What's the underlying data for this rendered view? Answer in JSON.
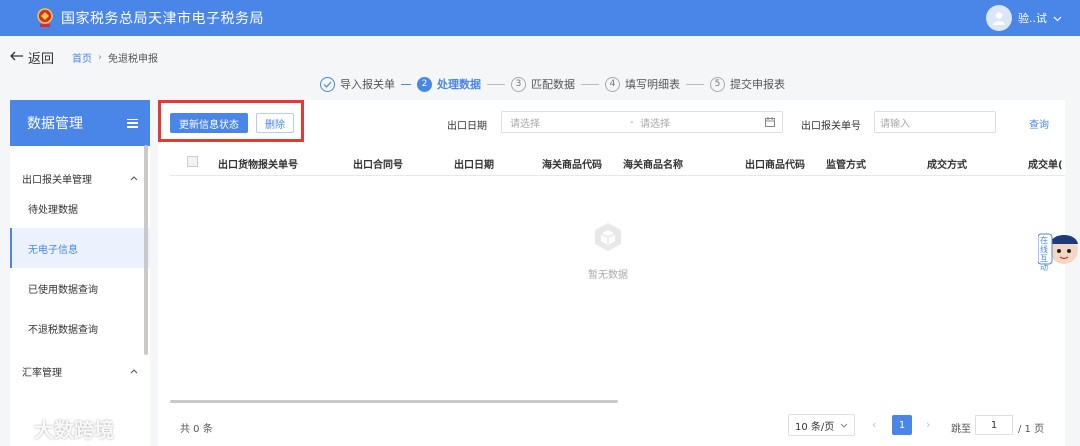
{
  "header": {
    "title": "国家税务总局天津市电子税务局",
    "user_name": "验..试"
  },
  "breadcrumb": {
    "back": "返回",
    "home": "首页",
    "sep": "›",
    "current": "免退税申报"
  },
  "steps": [
    {
      "num": "1",
      "label": "导入报关单",
      "state": "done"
    },
    {
      "num": "2",
      "label": "处理数据",
      "state": "active"
    },
    {
      "num": "3",
      "label": "匹配数据",
      "state": "todo"
    },
    {
      "num": "4",
      "label": "填写明细表",
      "state": "todo"
    },
    {
      "num": "5",
      "label": "提交申报表",
      "state": "todo"
    }
  ],
  "sidebar": {
    "title": "数据管理",
    "group1": "出口报关单管理",
    "items": [
      "待处理数据",
      "无电子信息",
      "已使用数据查询",
      "不退税数据查询"
    ],
    "group2": "汇率管理"
  },
  "toolbar": {
    "update_status": "更新信息状态",
    "delete": "删除",
    "date_label": "出口日期",
    "date_start_placeholder": "请选择",
    "date_sep": "-",
    "date_end_placeholder": "请选择",
    "declaration_label": "出口报关单号",
    "declaration_placeholder": "请输入",
    "query": "查询"
  },
  "table": {
    "columns": [
      "出口货物报关单号",
      "出口合同号",
      "出口日期",
      "海关商品代码",
      "海关商品名称",
      "出口商品代码",
      "监管方式",
      "成交方式",
      "成交单("
    ],
    "empty_text": "暂无数据"
  },
  "pagination": {
    "total": "共 0 条",
    "page_size": "10 条/页",
    "current_page": "1",
    "goto_label": "跳至",
    "goto_value": "1",
    "total_pages": "/ 1 页"
  },
  "mascot_text": "在线互动",
  "watermark": "大数跨境",
  "colors": {
    "primary": "#4a86e8",
    "highlight": "#e53935"
  }
}
